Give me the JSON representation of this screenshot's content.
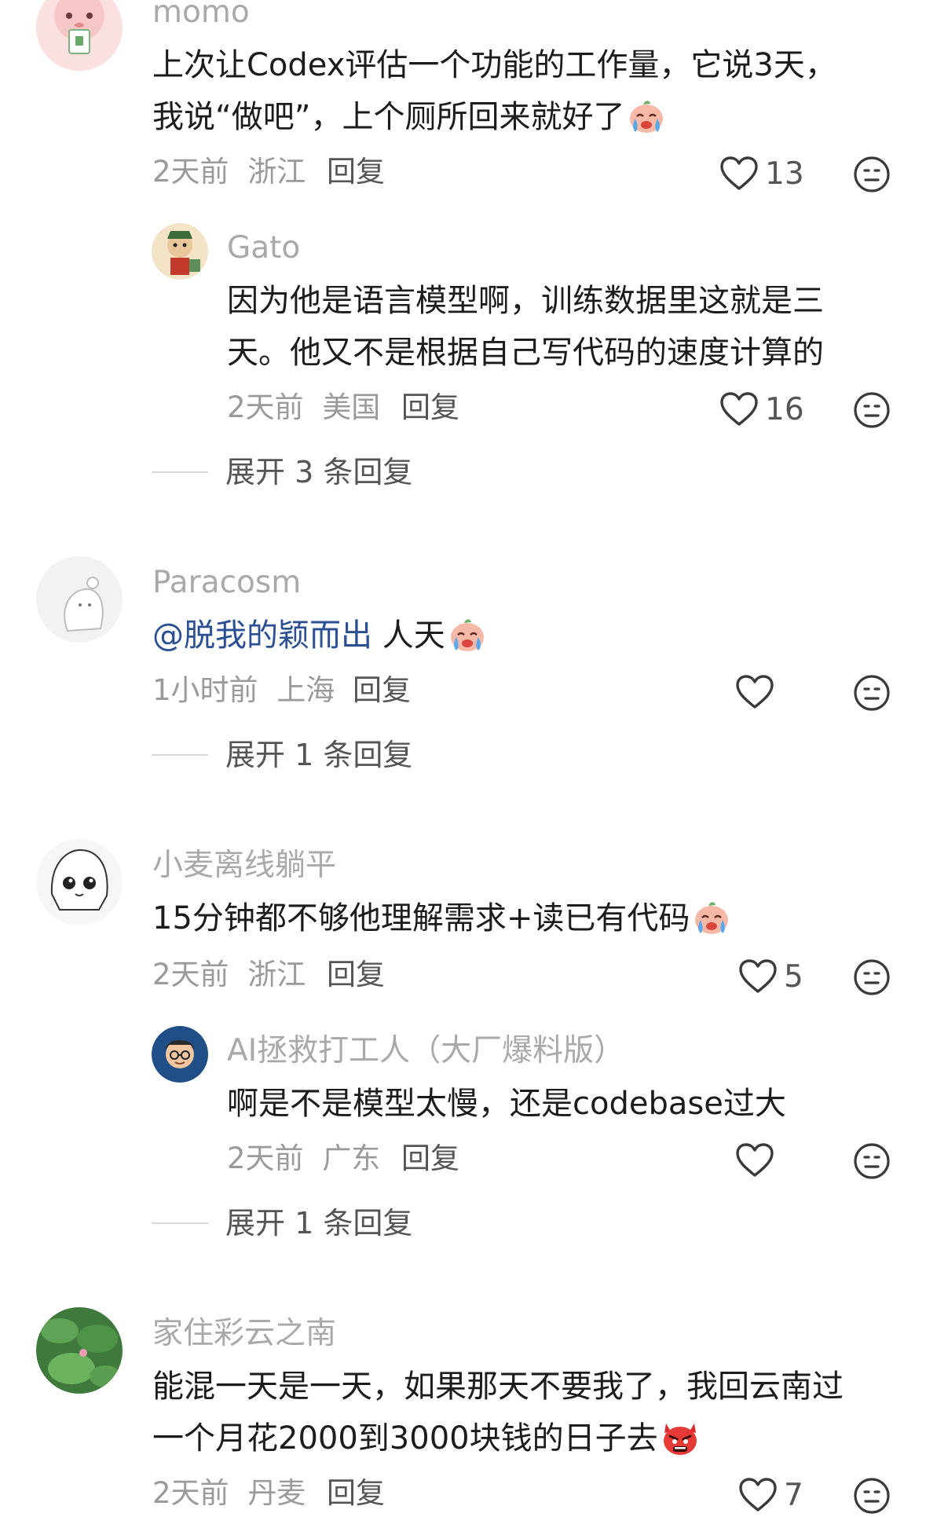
{
  "comments": [
    {
      "name": "momo",
      "text_line1": "上次让Codex评估一个功能的工作量，它说3天，",
      "text_line2": "我说“做吧”，上个厕所回来就好了",
      "time": "2天前",
      "location": "浙江",
      "reply_label": "回复",
      "likes": "13",
      "emoji": "crying-face"
    },
    {
      "name": "Gato",
      "text_line1": "因为他是语言模型啊，训练数据里这就是三",
      "text_line2": "天。他又不是根据自己写代码的速度计算的",
      "time": "2天前",
      "location": "美国",
      "reply_label": "回复",
      "likes": "16",
      "expand_label": "展开 3 条回复"
    },
    {
      "name": "Paracosm",
      "mention": "@脱我的颖而出",
      "text_line1": " 人天",
      "time": "1小时前",
      "location": "上海",
      "reply_label": "回复",
      "likes": "",
      "expand_label": "展开 1 条回复",
      "emoji": "crying-face"
    },
    {
      "name": "小麦离线躺平",
      "text_line1": "15分钟都不够他理解需求+读已有代码",
      "time": "2天前",
      "location": "浙江",
      "reply_label": "回复",
      "likes": "5",
      "emoji": "crying-face"
    },
    {
      "name": "AI拯救打工人（大厂爆料版）",
      "text_line1": "啊是不是模型太慢，还是codebase过大",
      "time": "2天前",
      "location": "广东",
      "reply_label": "回复",
      "likes": "",
      "expand_label": "展开 1 条回复"
    },
    {
      "name": "家住彩云之南",
      "text_line1": "能混一天是一天，如果那天不要我了，我回云南过",
      "text_line2": "一个月花2000到3000块钱的日子去",
      "time": "2天前",
      "location": "丹麦",
      "reply_label": "回复",
      "likes": "7",
      "emoji": "angry-devil-face"
    }
  ],
  "icons": {
    "like": "heart-outline-icon",
    "dislike": "meh-face-icon"
  },
  "colors": {
    "name": "#a9a9a9",
    "mention": "#2b4f93",
    "meta": "#9a9a9a"
  }
}
